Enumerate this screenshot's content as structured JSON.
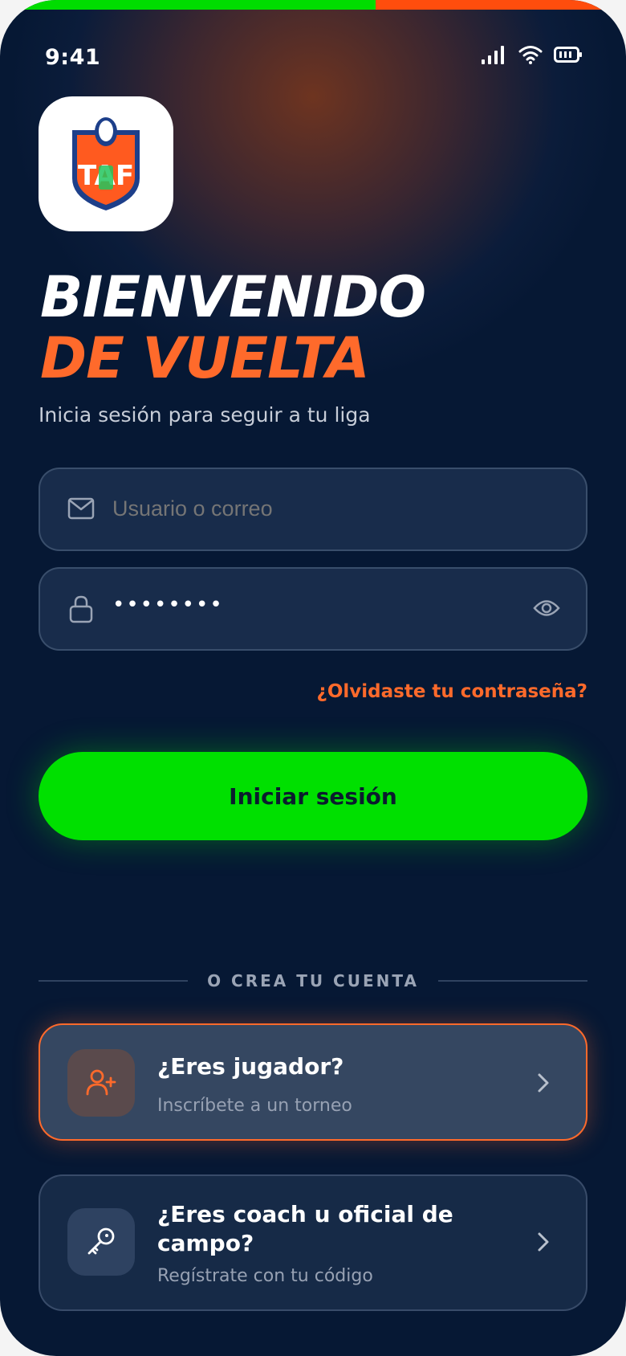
{
  "status_bar": {
    "time": "9:41"
  },
  "brand": {
    "logo_text": "TAF"
  },
  "headline": {
    "line1": "BIENVENIDO",
    "line2": "DE VUELTA"
  },
  "subtitle": "Inicia sesión para seguir a tu liga",
  "form": {
    "username": {
      "placeholder": "Usuario o correo",
      "value": ""
    },
    "password": {
      "masked_value": "••••••••"
    },
    "forgot_link": "¿Olvidaste tu contraseña?",
    "submit_label": "Iniciar sesión"
  },
  "signup": {
    "divider_label": "O CREA TU CUENTA",
    "player": {
      "title": "¿Eres jugador?",
      "subtitle": "Inscríbete a un torneo"
    },
    "coach": {
      "title": "¿Eres coach u oficial de campo?",
      "subtitle": "Regístrate con tu código"
    }
  },
  "colors": {
    "accent_green": "#00e000",
    "accent_orange": "#ff6a2b",
    "background": "#061834"
  },
  "icons": [
    "signal-icon",
    "wifi-icon",
    "battery-icon",
    "mail-icon",
    "lock-icon",
    "eye-icon",
    "user-plus-icon",
    "key-icon",
    "chevron-right-icon"
  ]
}
